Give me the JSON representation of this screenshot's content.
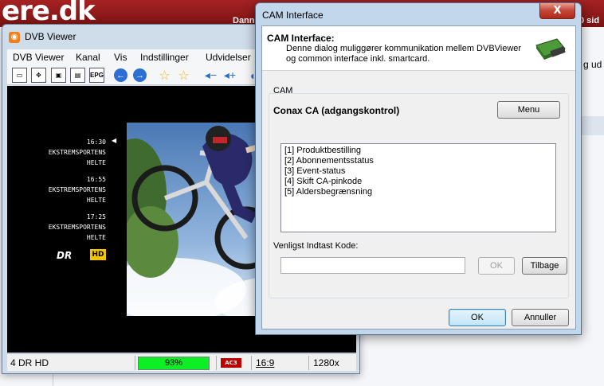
{
  "background_page": {
    "logo": "ere.dk",
    "user_text": "Dann",
    "pages_text": "0 sid",
    "right_text": "g ud"
  },
  "viewer": {
    "title": "DVB Viewer",
    "menu": [
      "DVB Viewer",
      "Kanal",
      "Vis",
      "Indstillinger",
      "Udvidelser"
    ],
    "toolbar_epg": "EPG",
    "epg": [
      {
        "time": "16:30",
        "line1": "EKSTREMSPORTENS",
        "line2": "HELTE"
      },
      {
        "time": "16:55",
        "line1": "EKSTREMSPORTENS",
        "line2": "HELTE"
      },
      {
        "time": "17:25",
        "line1": "EKSTREMSPORTENS",
        "line2": "HELTE"
      }
    ],
    "channel_logo": "DR",
    "hd_badge": "HD",
    "status": {
      "channel": "4 DR HD",
      "signal": "93%",
      "signal_level": 0.93,
      "audio_badge": "AC3",
      "aspect": "16:9",
      "resolution": "1280x"
    }
  },
  "dialog": {
    "title": "CAM Interface",
    "close_label": "X",
    "header_title": "CAM Interface:",
    "header_desc": "Denne dialog muliggører kommunikation mellem DVBViewer og common interface inkl. smartcard.",
    "group_label": "CAM",
    "cam_name": "Conax CA (adgangskontrol)",
    "menu_button": "Menu",
    "list_items": [
      "[1] Produktbestilling",
      "[2] Abonnementsstatus",
      "[3] Event-status",
      "[4] Skift CA-pinkode",
      "[5] Aldersbegrænsning"
    ],
    "code_label": "Venligst Indtast Kode:",
    "code_value": "",
    "code_ok_button": "OK",
    "back_button": "Tilbage",
    "ok_button": "OK",
    "cancel_button": "Annuller"
  },
  "colors": {
    "signal_green": "#0cef24",
    "site_red": "#a52222",
    "hd_yellow": "#f5c400"
  }
}
